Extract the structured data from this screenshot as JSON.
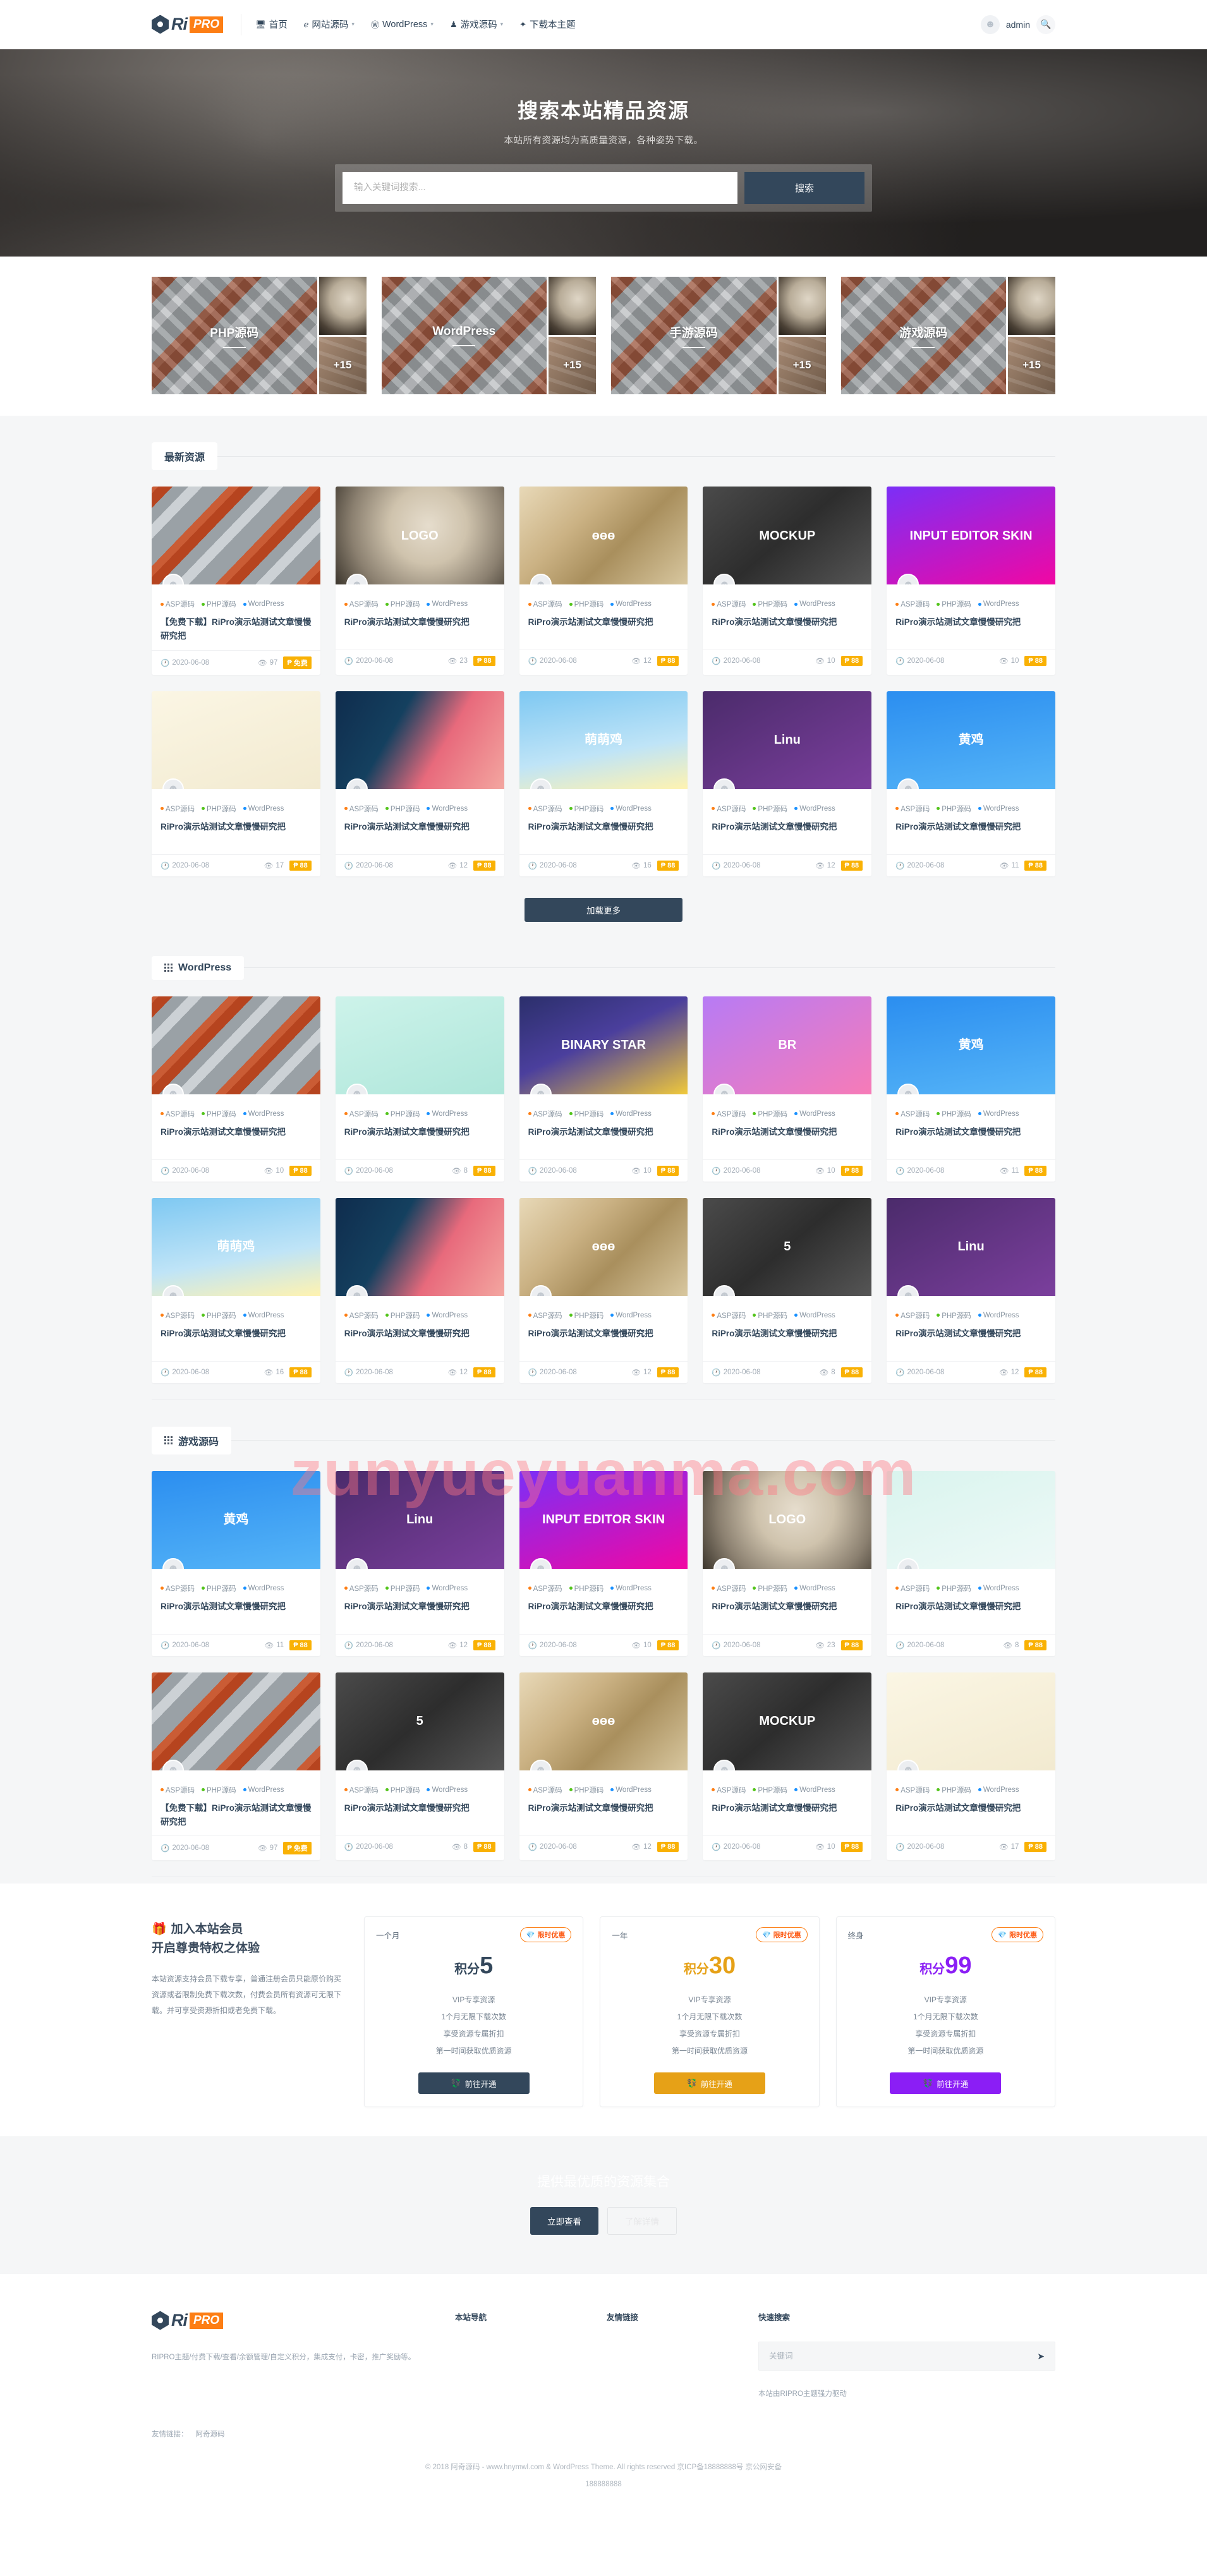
{
  "brand": {
    "ri": "Ri",
    "pro": "PRO"
  },
  "nav": {
    "items": [
      {
        "icon": "monitor-icon",
        "glyph": "Ὓ5",
        "label": "首页",
        "caret": false
      },
      {
        "icon": "code-icon",
        "label": "网站源码",
        "caret": true
      },
      {
        "icon": "wordpress-icon",
        "label": "WordPress",
        "caret": true
      },
      {
        "icon": "game-icon",
        "label": "游戏源码",
        "caret": true
      },
      {
        "icon": "download-icon",
        "label": "下载本主题",
        "caret": false
      }
    ]
  },
  "user": {
    "name": "admin",
    "avatar_icon": "user-avatar-icon",
    "search_icon": "search-icon"
  },
  "hero": {
    "title": "搜索本站精品资源",
    "subtitle": "本站所有资源均为高质量资源，各种姿势下载。",
    "placeholder": "输入关键词搜索...",
    "button": "搜索"
  },
  "categories": [
    {
      "label": "PHP源码",
      "extra": "+15"
    },
    {
      "label": "WordPress",
      "extra": "+15"
    },
    {
      "label": "手游源码",
      "extra": "+15"
    },
    {
      "label": "游戏源码",
      "extra": "+15"
    }
  ],
  "watermark": "zunyueyuanma.com",
  "tag_colors": {
    "asp": "#fd7e14",
    "php": "#52c41a",
    "wp": "#1890ff"
  },
  "tag_labels": {
    "asp": "ASP源码",
    "php": "PHP源码",
    "wp": "WordPress"
  },
  "sections": [
    {
      "title": "最新资源",
      "icon": "grid-icon",
      "show_icon": false,
      "more_button": "加载更多",
      "cards": [
        {
          "art": "t-cans",
          "art_text": "",
          "title": "【免费下载】RiPro演示站测试文章慢慢研究把",
          "date": "2020-06-08",
          "views": "97",
          "badge": "免费",
          "badge_icon": "p-icon"
        },
        {
          "art": "t-logo",
          "art_text": "LOGO",
          "title": "RiPro演示站测试文章慢慢研究把",
          "date": "2020-06-08",
          "views": "23",
          "badge": "88",
          "badge_icon": "p-icon"
        },
        {
          "art": "t-gold",
          "art_text": "ɵɵɵ",
          "title": "RiPro演示站测试文章慢慢研究把",
          "date": "2020-06-08",
          "views": "12",
          "badge": "88",
          "badge_icon": "p-icon"
        },
        {
          "art": "t-dark",
          "art_text": "MOCKUP",
          "title": "RiPro演示站测试文章慢慢研究把",
          "date": "2020-06-08",
          "views": "10",
          "badge": "88",
          "badge_icon": "p-icon"
        },
        {
          "art": "t-purple",
          "art_text": "INPUT EDITOR SKIN",
          "title": "RiPro演示站测试文章慢慢研究把",
          "date": "2020-06-08",
          "views": "10",
          "badge": "88",
          "badge_icon": "p-icon"
        },
        {
          "art": "t-mascot",
          "art_text": "",
          "title": "RiPro演示站测试文章慢慢研究把",
          "date": "2020-06-08",
          "views": "17",
          "badge": "88",
          "badge_icon": "p-icon"
        },
        {
          "art": "t-night",
          "art_text": "",
          "title": "RiPro演示站测试文章慢慢研究把",
          "date": "2020-06-08",
          "views": "12",
          "badge": "88",
          "badge_icon": "p-icon"
        },
        {
          "art": "t-chick",
          "art_text": "萌萌鸡",
          "title": "RiPro演示站测试文章慢慢研究把",
          "date": "2020-06-08",
          "views": "16",
          "badge": "88",
          "badge_icon": "p-icon"
        },
        {
          "art": "t-linu",
          "art_text": "Linu",
          "title": "RiPro演示站测试文章慢慢研究把",
          "date": "2020-06-08",
          "views": "12",
          "badge": "88",
          "badge_icon": "p-icon"
        },
        {
          "art": "t-yellow",
          "art_text": "黄鸡",
          "title": "RiPro演示站测试文章慢慢研究把",
          "date": "2020-06-08",
          "views": "11",
          "badge": "88",
          "badge_icon": "p-icon"
        }
      ]
    },
    {
      "title": "WordPress",
      "icon": "grid-icon",
      "show_icon": true,
      "more_button": null,
      "cards": [
        {
          "art": "t-cans",
          "art_text": "",
          "title": "RiPro演示站测试文章慢慢研究把",
          "date": "2020-06-08",
          "views": "10",
          "badge": "88",
          "badge_icon": "p-icon"
        },
        {
          "art": "t-mint",
          "art_text": "",
          "title": "RiPro演示站测试文章慢慢研究把",
          "date": "2020-06-08",
          "views": "8",
          "badge": "88",
          "badge_icon": "p-icon"
        },
        {
          "art": "t-binary",
          "art_text": "BINARY STAR",
          "title": "RiPro演示站测试文章慢慢研究把",
          "date": "2020-06-08",
          "views": "10",
          "badge": "88",
          "badge_icon": "p-icon"
        },
        {
          "art": "t-bright",
          "art_text": "BR",
          "title": "RiPro演示站测试文章慢慢研究把",
          "date": "2020-06-08",
          "views": "10",
          "badge": "88",
          "badge_icon": "p-icon"
        },
        {
          "art": "t-yellow",
          "art_text": "黄鸡",
          "title": "RiPro演示站测试文章慢慢研究把",
          "date": "2020-06-08",
          "views": "11",
          "badge": "88",
          "badge_icon": "p-icon"
        },
        {
          "art": "t-chick",
          "art_text": "萌萌鸡",
          "title": "RiPro演示站测试文章慢慢研究把",
          "date": "2020-06-08",
          "views": "16",
          "badge": "88",
          "badge_icon": "p-icon"
        },
        {
          "art": "t-night",
          "art_text": "",
          "title": "RiPro演示站测试文章慢慢研究把",
          "date": "2020-06-08",
          "views": "12",
          "badge": "88",
          "badge_icon": "p-icon"
        },
        {
          "art": "t-gold",
          "art_text": "ɵɵɵ",
          "title": "RiPro演示站测试文章慢慢研究把",
          "date": "2020-06-08",
          "views": "12",
          "badge": "88",
          "badge_icon": "p-icon"
        },
        {
          "art": "t-dark",
          "art_text": "5",
          "title": "RiPro演示站测试文章慢慢研究把",
          "date": "2020-06-08",
          "views": "8",
          "badge": "88",
          "badge_icon": "p-icon"
        },
        {
          "art": "t-linu",
          "art_text": "Linu",
          "title": "RiPro演示站测试文章慢慢研究把",
          "date": "2020-06-08",
          "views": "12",
          "badge": "88",
          "badge_icon": "p-icon"
        }
      ]
    },
    {
      "title": "游戏源码",
      "icon": "grid-icon",
      "show_icon": true,
      "more_button": null,
      "cards": [
        {
          "art": "t-yellow",
          "art_text": "黄鸡",
          "title": "RiPro演示站测试文章慢慢研究把",
          "date": "2020-06-08",
          "views": "11",
          "badge": "88",
          "badge_icon": "p-icon"
        },
        {
          "art": "t-linu",
          "art_text": "Linu",
          "title": "RiPro演示站测试文章慢慢研究把",
          "date": "2020-06-08",
          "views": "12",
          "badge": "88",
          "badge_icon": "p-icon"
        },
        {
          "art": "t-purple",
          "art_text": "INPUT EDITOR SKIN",
          "title": "RiPro演示站测试文章慢慢研究把",
          "date": "2020-06-08",
          "views": "10",
          "badge": "88",
          "badge_icon": "p-icon"
        },
        {
          "art": "t-logo",
          "art_text": "LOGO",
          "title": "RiPro演示站测试文章慢慢研究把",
          "date": "2020-06-08",
          "views": "23",
          "badge": "88",
          "badge_icon": "p-icon"
        },
        {
          "art": "t-shoe",
          "art_text": "",
          "title": "RiPro演示站测试文章慢慢研究把",
          "date": "2020-06-08",
          "views": "8",
          "badge": "88",
          "badge_icon": "p-icon"
        },
        {
          "art": "t-cans",
          "art_text": "",
          "title": "【免费下载】RiPro演示站测试文章慢慢研究把",
          "date": "2020-06-08",
          "views": "97",
          "badge": "免费",
          "badge_icon": "p-icon"
        },
        {
          "art": "t-dark",
          "art_text": "5",
          "title": "RiPro演示站测试文章慢慢研究把",
          "date": "2020-06-08",
          "views": "8",
          "badge": "88",
          "badge_icon": "p-icon"
        },
        {
          "art": "t-gold",
          "art_text": "ɵɵɵ",
          "title": "RiPro演示站测试文章慢慢研究把",
          "date": "2020-06-08",
          "views": "12",
          "badge": "88",
          "badge_icon": "p-icon"
        },
        {
          "art": "t-dark",
          "art_text": "MOCKUP",
          "title": "RiPro演示站测试文章慢慢研究把",
          "date": "2020-06-08",
          "views": "10",
          "badge": "88",
          "badge_icon": "p-icon"
        },
        {
          "art": "t-mascot",
          "art_text": "",
          "title": "RiPro演示站测试文章慢慢研究把",
          "date": "2020-06-08",
          "views": "17",
          "badge": "88",
          "badge_icon": "p-icon"
        }
      ]
    }
  ],
  "vip": {
    "icon": "gift-icon",
    "heading1": "加入本站会员",
    "heading2": "开启尊贵特权之体验",
    "desc": "本站资源支持会员下载专享，普通注册会员只能原价购买资源或者限制免费下载次数，付费会员所有资源可无限下载。并可享受资源折扣或者免费下载。",
    "tag_label": "限时优惠",
    "tag_icon": "diamond-icon",
    "button_icon": "coins-icon",
    "plans": [
      {
        "name": "一个月",
        "unit": "积分",
        "num": "5",
        "color": "#33475b",
        "features": [
          "VIP专享资源",
          "1个月无限下载次数",
          "享受资源专属折扣",
          "第一时间获取优质资源"
        ],
        "button": "前往开通"
      },
      {
        "name": "一年",
        "unit": "积分",
        "num": "30",
        "color": "#e6a117",
        "features": [
          "VIP专享资源",
          "1个月无限下载次数",
          "享受资源专属折扣",
          "第一时间获取优质资源"
        ],
        "button": "前往开通"
      },
      {
        "name": "终身",
        "unit": "积分",
        "num": "99",
        "color": "#8b1ef5",
        "features": [
          "VIP专享资源",
          "1个月无限下载次数",
          "享受资源专属折扣",
          "第一时间获取优质资源"
        ],
        "button": "前往开通"
      }
    ]
  },
  "cta": {
    "title": "提供最优质的资源集合",
    "btn1": "立即查看",
    "btn2": "了解详情"
  },
  "footer": {
    "about": "RIPRO主题/付费下载/查看/余额管理/自定义积分，集成支付，卡密，推广奖励等。",
    "col2_title": "本站导航",
    "col3_title": "友情链接",
    "col4_title": "快速搜索",
    "search_placeholder": "关键词",
    "send_icon": "send-icon",
    "powered": "本站由RIPRO主题强力驱动",
    "links_label": "友情链接：",
    "links": [
      "阿奇源码"
    ],
    "copyright": "© 2018 阿奇源码 - www.hnymwl.com & WordPress Theme. All rights reserved  京ICP备18888888号  京公网安备",
    "copyright2": "188888888"
  }
}
